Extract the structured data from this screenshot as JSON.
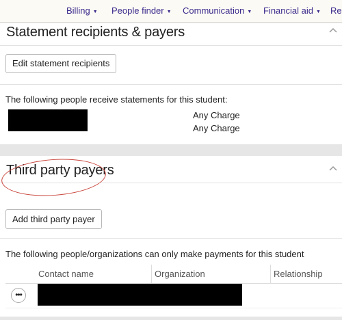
{
  "nav": {
    "items": [
      {
        "label": "Billing"
      },
      {
        "label": "People finder"
      },
      {
        "label": "Communication"
      },
      {
        "label": "Financial aid"
      },
      {
        "label": "Rep"
      }
    ]
  },
  "statement_panel": {
    "title": "Statement recipients & payers",
    "edit_button": "Edit statement recipients",
    "description": "The following people receive statements for this student:",
    "recipients": [
      {
        "charge": "Any Charge"
      },
      {
        "charge": "Any Charge"
      }
    ]
  },
  "third_party_panel": {
    "title": "Third party payers",
    "add_button": "Add third party payer",
    "description": "The following people/organizations can only make payments for this student",
    "table": {
      "columns": [
        "Contact name",
        "Organization",
        "Relationship"
      ],
      "row_menu": "•••"
    }
  },
  "colors": {
    "nav_link": "#3a2a8c",
    "annotation_circle": "#c9443a"
  }
}
